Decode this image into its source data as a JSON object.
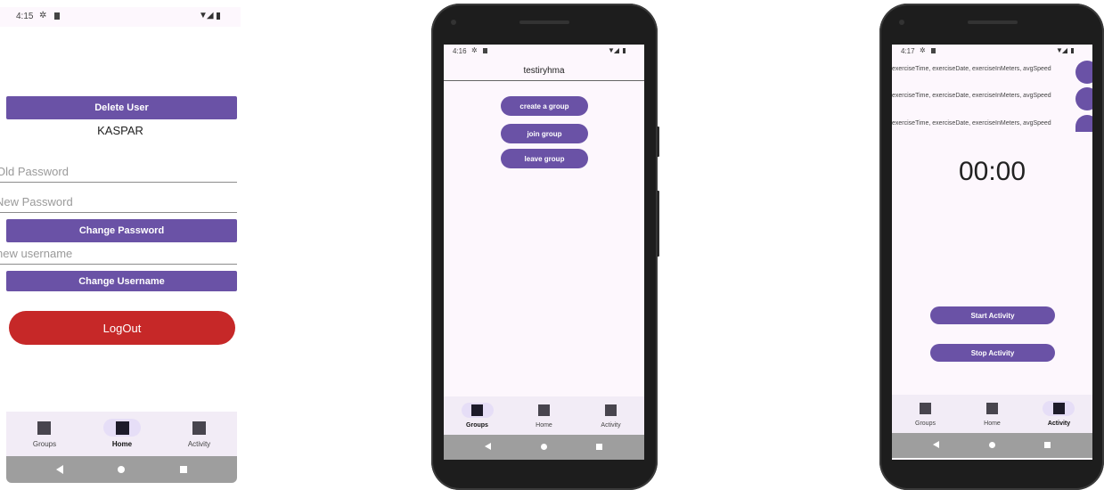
{
  "panel1": {
    "status": {
      "time": "4:15"
    },
    "delete_user": "Delete User",
    "username_display": "KASPAR",
    "old_password_placeholder": "Old Password",
    "new_password_placeholder": "New Password",
    "change_password": "Change Password",
    "new_username_placeholder": "new username",
    "change_username": "Change Username",
    "logout": "LogOut",
    "nav": [
      {
        "label": "Groups"
      },
      {
        "label": "Home"
      },
      {
        "label": "Activity"
      }
    ],
    "active_tab": "Home"
  },
  "panel2": {
    "status": {
      "time": "4:16"
    },
    "title": "testiryhma",
    "buttons": [
      "create a group",
      "join group",
      "leave group"
    ],
    "nav": [
      {
        "label": "Groups"
      },
      {
        "label": "Home"
      },
      {
        "label": "Activity"
      }
    ],
    "active_tab": "Groups"
  },
  "panel3": {
    "status": {
      "time": "4:17"
    },
    "exercise_rows": [
      "exerciseTime, exerciseDate, exerciseInMeters, avgSpeed",
      "exerciseTime, exerciseDate, exerciseInMeters, avgSpeed",
      "exerciseTime, exerciseDate, exerciseInMeters, avgSpeed"
    ],
    "timer": "00:00",
    "start_activity": "Start Activity",
    "stop_activity": "Stop Activity",
    "nav": [
      {
        "label": "Groups"
      },
      {
        "label": "Home"
      },
      {
        "label": "Activity"
      }
    ],
    "active_tab": "Activity"
  },
  "colors": {
    "primary": "#6a52a6",
    "logout": "#c62828",
    "nav_bg": "#f2ecf6",
    "screen_bg": "#fdf7fd",
    "system_bar": "#9e9e9e"
  },
  "icons": [
    "settings-icon",
    "sd-card-icon",
    "wifi-icon",
    "signal-icon",
    "battery-icon",
    "nav-square-icon",
    "back-icon",
    "home-circle-icon",
    "recents-icon"
  ]
}
